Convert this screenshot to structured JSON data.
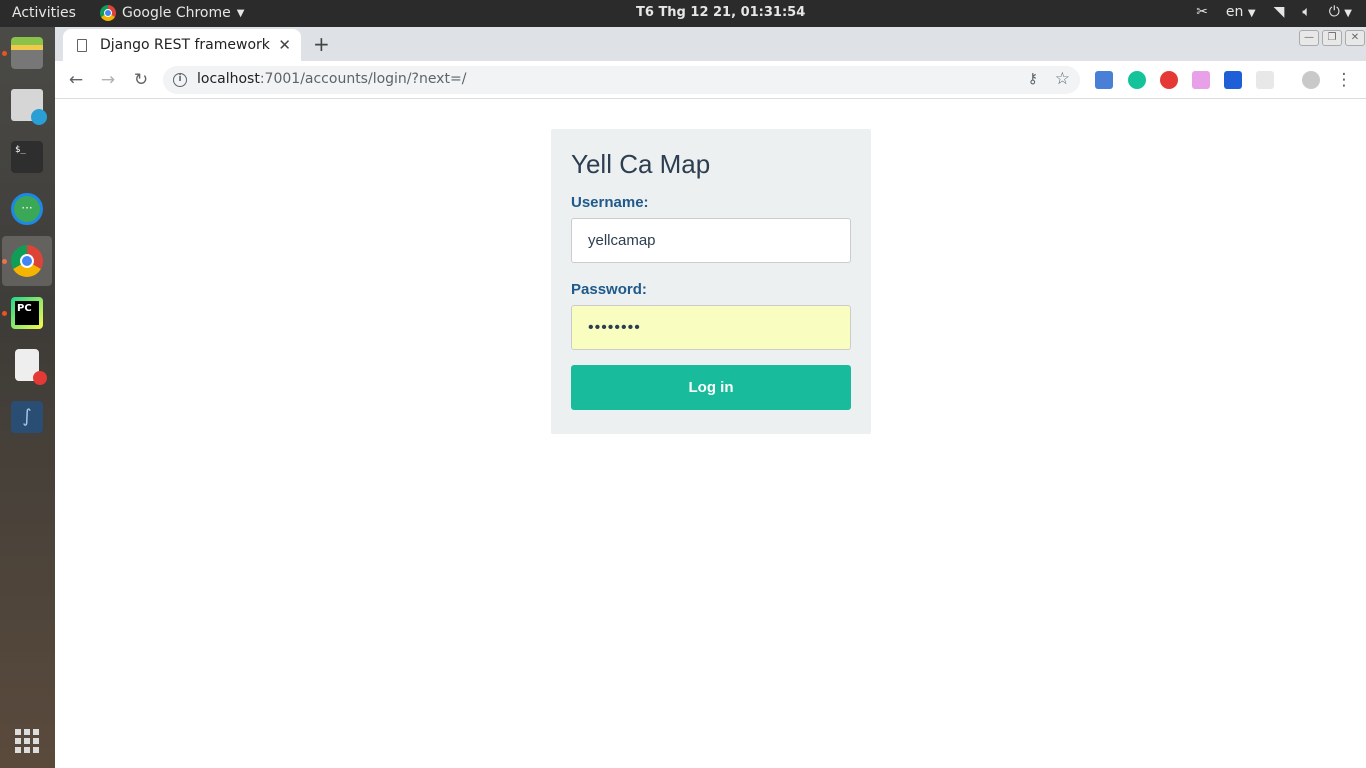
{
  "topbar": {
    "activities": "Activities",
    "app_name": "Google Chrome",
    "clock": "T6 Thg 12 21, 01:31:54",
    "lang": "en"
  },
  "dock": {
    "items": [
      "file-manager",
      "software-updater",
      "terminal",
      "messaging",
      "google-chrome",
      "pycharm",
      "text-editor",
      "mysql-workbench"
    ],
    "show_apps": "show-applications"
  },
  "browser": {
    "tab_title": "Django REST framework",
    "url_host": "localhost",
    "url_rest": ":7001/accounts/login/?next=/"
  },
  "login": {
    "title": "Yell Ca Map",
    "username_label": "Username:",
    "username_value": "yellcamap",
    "password_label": "Password:",
    "password_value": "••••••••",
    "button": "Log in"
  },
  "colors": {
    "accent": "#18bc9c",
    "label": "#1f5a8a",
    "panel": "#ecf0f1",
    "autofill": "#fafdc0"
  }
}
